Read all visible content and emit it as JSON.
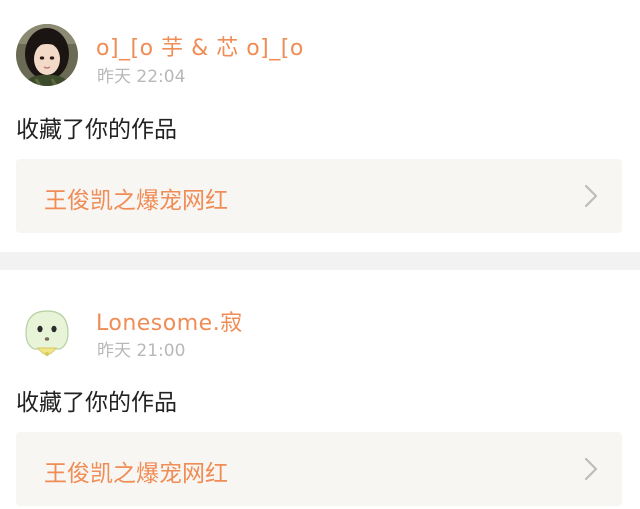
{
  "notifications": [
    {
      "username": "o]_[o 芋 & 芯 o]_[o",
      "time": "昨天 22:04",
      "action": "收藏了你的作品",
      "work_title": "王俊凯之爆宠网红",
      "avatar_icon": "girl-photo-avatar-icon",
      "chevron_icon": "chevron-right-icon"
    },
    {
      "username": "Lonesome.寂",
      "time": "昨天 21:00",
      "action": "收藏了你的作品",
      "work_title": "王俊凯之爆宠网红",
      "avatar_icon": "cartoon-ghost-avatar-icon",
      "chevron_icon": "chevron-right-icon"
    }
  ],
  "colors": {
    "accent": "#f08c55",
    "timestamp": "#b8b8b8",
    "link_background": "#f7f6f2",
    "separator": "#f2f2f2"
  }
}
